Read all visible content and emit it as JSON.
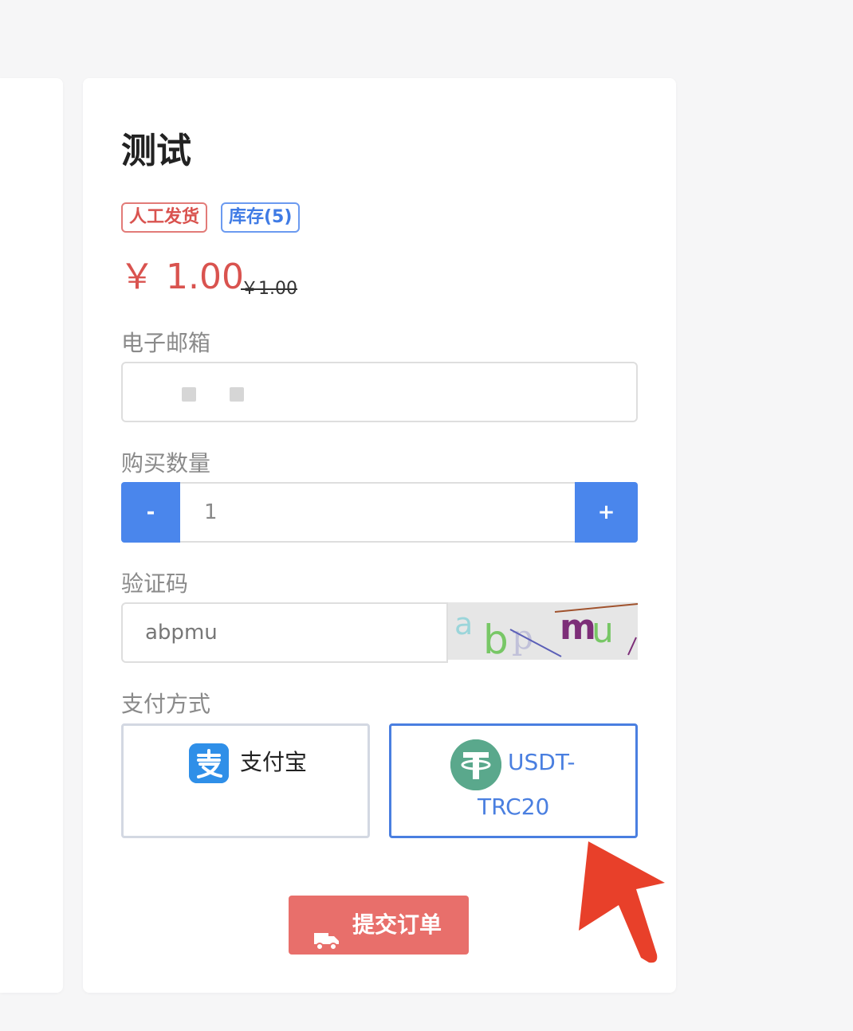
{
  "product": {
    "title": "测试",
    "tags": {
      "delivery": "人工发货",
      "stock": "库存(5)"
    },
    "price": "￥ 1.00",
    "original_price": "￥1.00"
  },
  "form": {
    "email": {
      "label": "电子邮箱",
      "value": ""
    },
    "quantity": {
      "label": "购买数量",
      "minus": "-",
      "value": "1",
      "plus": "+"
    },
    "captcha": {
      "label": "验证码",
      "value": "abpmu",
      "image_text": "abpmu"
    },
    "payment": {
      "label": "支付方式",
      "options": [
        {
          "name": "支付宝",
          "icon": "alipay-icon",
          "selected": false
        },
        {
          "name_line1": "USDT-",
          "name_line2": "TRC20",
          "icon": "tether-icon",
          "selected": true
        }
      ]
    },
    "submit": {
      "label": "提交订单",
      "icon": "truck-icon"
    }
  },
  "colors": {
    "accent_blue": "#4a86ec",
    "price_red": "#d9534f",
    "submit_red": "#e86f6b",
    "tether_green": "#5aa88c",
    "pointer_red": "#e8402a"
  }
}
